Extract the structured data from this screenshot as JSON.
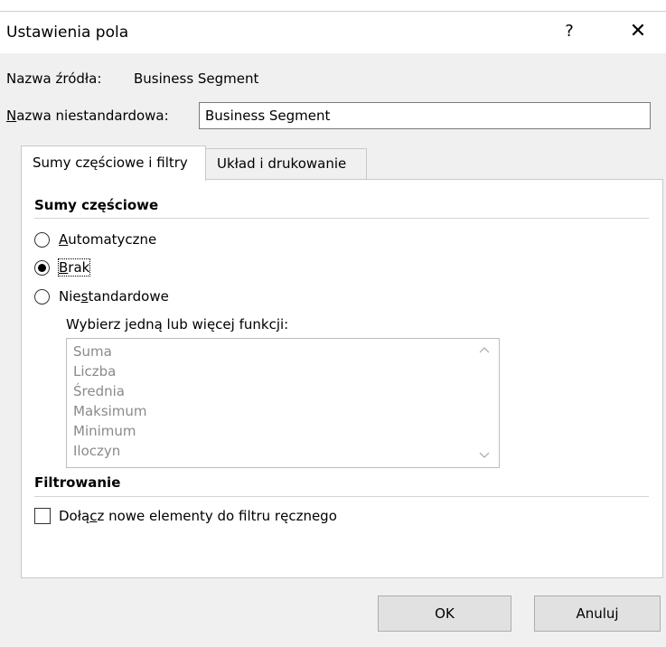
{
  "dialog": {
    "title": "Ustawienia pola",
    "help_label": "?",
    "close_label": "✕"
  },
  "source": {
    "label": "Nazwa źródła:",
    "value": "Business Segment"
  },
  "custom_name": {
    "label_first": "N",
    "label_rest": "azwa niestandardowa:",
    "value": "Business Segment"
  },
  "tabs": [
    {
      "label": "Sumy częściowe i filtry"
    },
    {
      "label": "Układ i drukowanie"
    }
  ],
  "subtotals": {
    "heading": "Sumy częściowe",
    "options": [
      {
        "label_first": "A",
        "label_rest": "utomatyczne",
        "selected": false
      },
      {
        "label_first": "B",
        "label_rest": "rak",
        "selected": true
      },
      {
        "label_pre": "Nie",
        "label_u": "s",
        "label_post": "tandardowe",
        "selected": false
      }
    ],
    "functions_label": "Wybierz jedną lub więcej funkcji:",
    "functions": [
      "Suma",
      "Liczba",
      "Średnia",
      "Maksimum",
      "Minimum",
      "Iloczyn"
    ]
  },
  "filtering": {
    "heading": "Filtrowanie",
    "include_pre": "Dołą",
    "include_u": "c",
    "include_post": "z nowe elementy do filtru ręcznego",
    "include_checked": false
  },
  "buttons": {
    "ok": "OK",
    "cancel": "Anuluj"
  },
  "colors": {
    "dialog_bg": "#f0f0f0",
    "panel_bg": "#ffffff",
    "disabled_text": "#8a8a8a"
  }
}
